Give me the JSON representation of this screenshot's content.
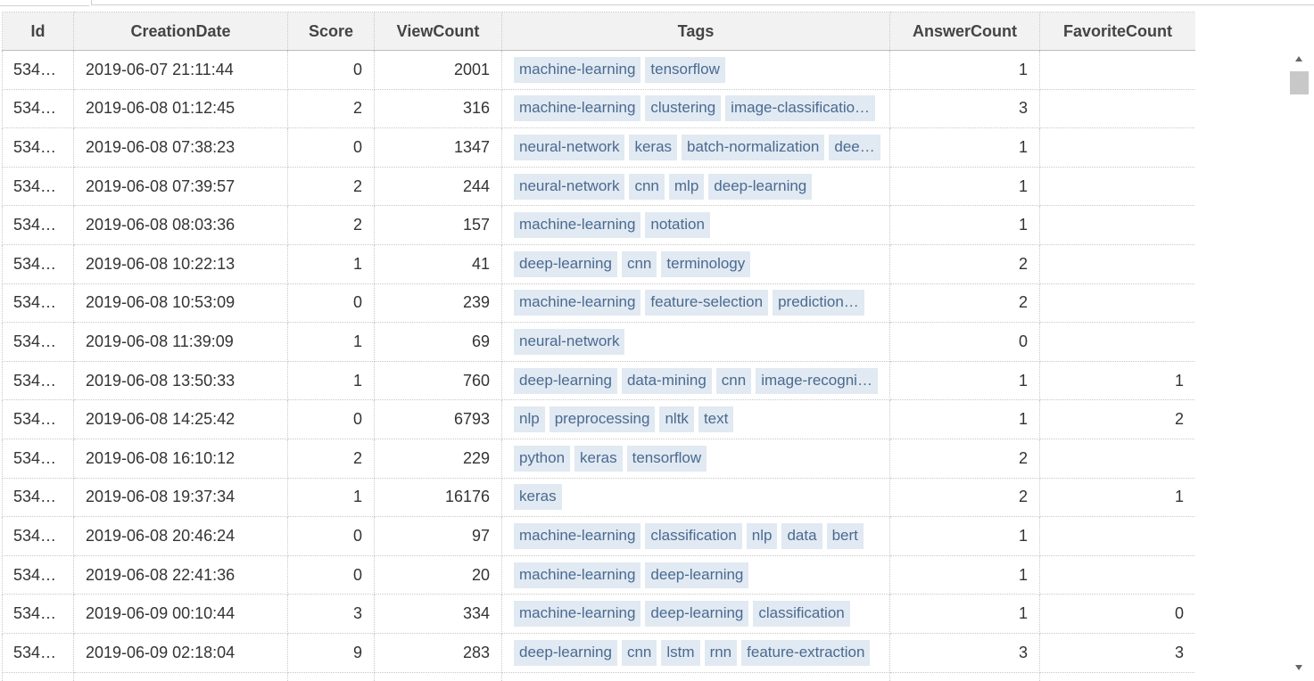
{
  "columns": [
    "Id",
    "CreationDate",
    "Score",
    "ViewCount",
    "Tags",
    "AnswerCount",
    "FavoriteCount"
  ],
  "rows": [
    {
      "id": "534…",
      "date": "2019-06-07 21:11:44",
      "score": "0",
      "views": "2001",
      "tags": [
        "machine-learning",
        "tensorflow"
      ],
      "answers": "1",
      "favorites": ""
    },
    {
      "id": "534…",
      "date": "2019-06-08 01:12:45",
      "score": "2",
      "views": "316",
      "tags": [
        "machine-learning",
        "clustering",
        "image-classificatio…"
      ],
      "answers": "3",
      "favorites": ""
    },
    {
      "id": "534…",
      "date": "2019-06-08 07:38:23",
      "score": "0",
      "views": "1347",
      "tags": [
        "neural-network",
        "keras",
        "batch-normalization",
        "dee…"
      ],
      "answers": "1",
      "favorites": ""
    },
    {
      "id": "534…",
      "date": "2019-06-08 07:39:57",
      "score": "2",
      "views": "244",
      "tags": [
        "neural-network",
        "cnn",
        "mlp",
        "deep-learning"
      ],
      "answers": "1",
      "favorites": ""
    },
    {
      "id": "534…",
      "date": "2019-06-08 08:03:36",
      "score": "2",
      "views": "157",
      "tags": [
        "machine-learning",
        "notation"
      ],
      "answers": "1",
      "favorites": ""
    },
    {
      "id": "534…",
      "date": "2019-06-08 10:22:13",
      "score": "1",
      "views": "41",
      "tags": [
        "deep-learning",
        "cnn",
        "terminology"
      ],
      "answers": "2",
      "favorites": ""
    },
    {
      "id": "534…",
      "date": "2019-06-08 10:53:09",
      "score": "0",
      "views": "239",
      "tags": [
        "machine-learning",
        "feature-selection",
        "prediction…"
      ],
      "answers": "2",
      "favorites": ""
    },
    {
      "id": "534…",
      "date": "2019-06-08 11:39:09",
      "score": "1",
      "views": "69",
      "tags": [
        "neural-network"
      ],
      "answers": "0",
      "favorites": ""
    },
    {
      "id": "534…",
      "date": "2019-06-08 13:50:33",
      "score": "1",
      "views": "760",
      "tags": [
        "deep-learning",
        "data-mining",
        "cnn",
        "image-recogni…"
      ],
      "answers": "1",
      "favorites": "1"
    },
    {
      "id": "534…",
      "date": "2019-06-08 14:25:42",
      "score": "0",
      "views": "6793",
      "tags": [
        "nlp",
        "preprocessing",
        "nltk",
        "text"
      ],
      "answers": "1",
      "favorites": "2"
    },
    {
      "id": "534…",
      "date": "2019-06-08 16:10:12",
      "score": "2",
      "views": "229",
      "tags": [
        "python",
        "keras",
        "tensorflow"
      ],
      "answers": "2",
      "favorites": ""
    },
    {
      "id": "534…",
      "date": "2019-06-08 19:37:34",
      "score": "1",
      "views": "16176",
      "tags": [
        "keras"
      ],
      "answers": "2",
      "favorites": "1"
    },
    {
      "id": "534…",
      "date": "2019-06-08 20:46:24",
      "score": "0",
      "views": "97",
      "tags": [
        "machine-learning",
        "classification",
        "nlp",
        "data",
        "bert"
      ],
      "answers": "1",
      "favorites": ""
    },
    {
      "id": "534…",
      "date": "2019-06-08 22:41:36",
      "score": "0",
      "views": "20",
      "tags": [
        "machine-learning",
        "deep-learning"
      ],
      "answers": "1",
      "favorites": ""
    },
    {
      "id": "534…",
      "date": "2019-06-09 00:10:44",
      "score": "3",
      "views": "334",
      "tags": [
        "machine-learning",
        "deep-learning",
        "classification"
      ],
      "answers": "1",
      "favorites": "0"
    },
    {
      "id": "534…",
      "date": "2019-06-09 02:18:04",
      "score": "9",
      "views": "283",
      "tags": [
        "deep-learning",
        "cnn",
        "lstm",
        "rnn",
        "feature-extraction"
      ],
      "answers": "3",
      "favorites": "3"
    },
    {
      "id": "",
      "date": "",
      "score": "",
      "views": "",
      "tags": [],
      "answers": "",
      "favorites": ""
    }
  ]
}
